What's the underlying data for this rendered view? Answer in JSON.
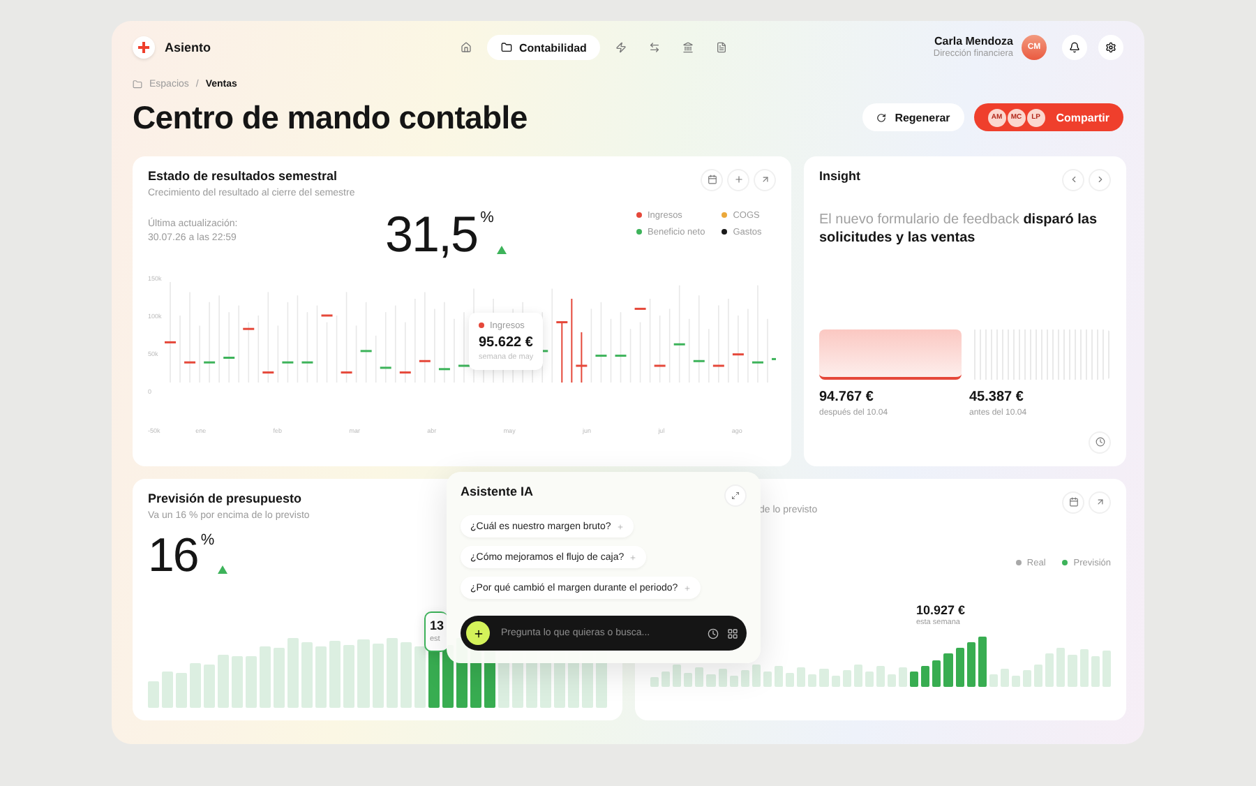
{
  "app": {
    "name": "Asiento"
  },
  "nav": [
    {
      "selected": false
    },
    {
      "label": "Contabilidad",
      "selected": true
    },
    {
      "selected": false
    },
    {
      "selected": false
    },
    {
      "selected": false
    },
    {
      "selected": false
    }
  ],
  "user": {
    "name": "Carla Mendoza",
    "role": "Dirección financiera",
    "initials": "CM"
  },
  "breadcrumb": {
    "items": [
      "Espacios",
      "Ventas"
    ],
    "separator": "/"
  },
  "page_title": "Centro de mando contable",
  "actions": {
    "regenerate": "Regenerar",
    "share": "Compartir",
    "share_avatars": [
      "AM",
      "MC",
      "LP"
    ]
  },
  "results": {
    "title": "Estado de resultados semestral",
    "subtitle": "Crecimiento del resultado al cierre del semestre",
    "updated_label": "Última actualización:",
    "updated_value": "30.07.26 a las 22:59",
    "value": "31,5",
    "unit": "%",
    "legend": [
      {
        "label": "Ingresos",
        "color": "#e5483a"
      },
      {
        "label": "COGS",
        "color": "#eba83a"
      },
      {
        "label": "Beneficio neto",
        "color": "#3db35a"
      },
      {
        "label": "Gastos",
        "color": "#1a1a1a"
      }
    ],
    "yticks": [
      "150k",
      "100k",
      "50k",
      "0",
      "-50k"
    ],
    "months": [
      "ene",
      "feb",
      "mar",
      "abr",
      "may",
      "jun",
      "jul",
      "ago"
    ],
    "tooltip": {
      "series": "Ingresos",
      "value": "95.622 €",
      "period": "semana de may"
    }
  },
  "insight": {
    "title": "Insight",
    "text": "El nuevo formulario de feedback **disparó las solicitudes y las ventas**",
    "after_value": "94.767 €",
    "after_label": "después del 10.04",
    "before_value": "45.387 €",
    "before_label": "antes del 10.04"
  },
  "budget": {
    "title": "Previsión de presupuesto",
    "subtitle": "Va un 16 % por encima de lo previsto",
    "value": "16",
    "unit": "%",
    "tooltip_value": "13",
    "tooltip_label": "est"
  },
  "forecast": {
    "subtitle": "de lo previsto",
    "legend": [
      {
        "label": "Real",
        "color": "#a8a8a8"
      },
      {
        "label": "Previsión",
        "color": "#3db35a"
      }
    ],
    "value": "10.927 €",
    "label": "esta semana"
  },
  "assistant": {
    "title": "Asistente IA",
    "suggestions": [
      "¿Cuál es nuestro margen bruto?",
      "¿Cómo mejoramos el flujo de caja?",
      "¿Por qué cambió el margen durante el periodo?"
    ],
    "placeholder": "Pregunta lo que quieras o busca..."
  }
}
